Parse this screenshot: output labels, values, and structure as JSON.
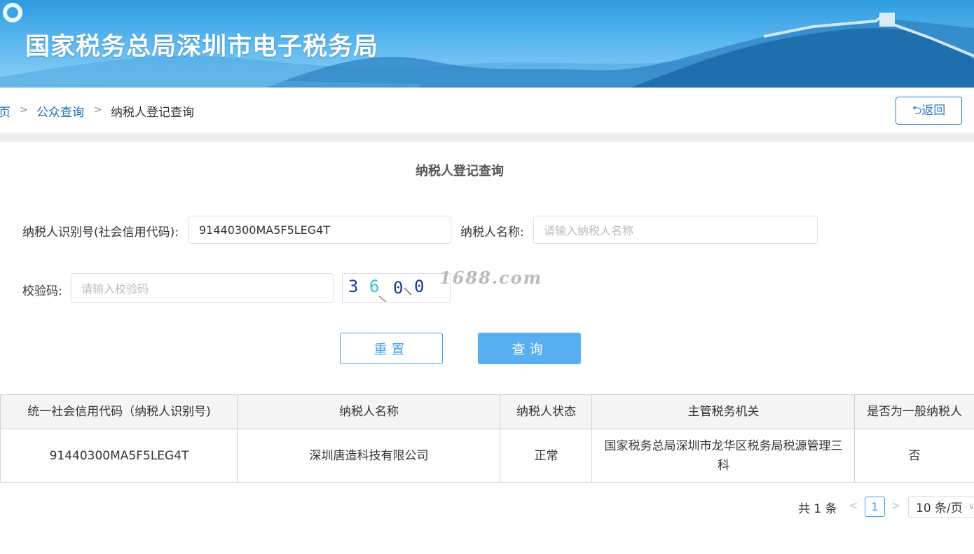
{
  "banner": {
    "title": "国家税务总局深圳市电子税务局"
  },
  "breadcrumb": {
    "home": "页",
    "sep": ">",
    "public_query": "公众查询",
    "current": "纳税人登记查询"
  },
  "back_button": "⮌返回",
  "page_title": "纳税人登记查询",
  "form": {
    "taxpayer_id_label": "纳税人识别号(社会信用代码):",
    "taxpayer_id_value": "91440300MA5F5LEG4T",
    "taxpayer_name_label": "纳税人名称:",
    "taxpayer_name_placeholder": "请输入纳税人名称",
    "captcha_label": "校验码:",
    "captcha_placeholder": "请输入校验码",
    "captcha_text": [
      "3",
      "6",
      "0",
      "0"
    ],
    "watermark": "1688.com",
    "reset_label": "重置",
    "query_label": "查询"
  },
  "table": {
    "headers": [
      "统一社会信用代码（纳税人识别号)",
      "纳税人名称",
      "纳税人状态",
      "主管税务机关",
      "是否为一般纳税人"
    ],
    "rows": [
      [
        "91440300MA5F5LEG4T",
        "深圳唐造科技有限公司",
        "正常",
        "国家税务总局深圳市龙华区税务局税源管理三科",
        "否"
      ]
    ]
  },
  "pagination": {
    "total": "共 1 条",
    "current_page": "1",
    "page_size": "10 条/页",
    "prev_icon": "chevron-left-icon",
    "next_icon": "chevron-right-icon"
  },
  "colors": {
    "link": "#1a6fb5",
    "primary": "#57aef0",
    "banner": "#3aa5e6"
  }
}
